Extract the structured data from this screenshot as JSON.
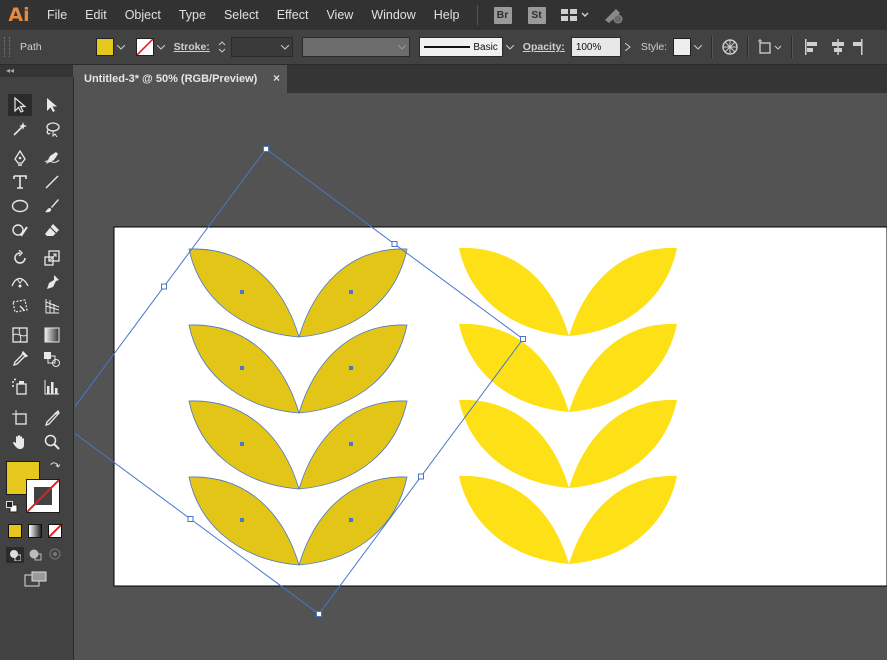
{
  "app": {
    "logo": "Ai"
  },
  "menu": [
    "File",
    "Edit",
    "Object",
    "Type",
    "Select",
    "Effect",
    "View",
    "Window",
    "Help"
  ],
  "bridge": {
    "br": "Br",
    "st": "St"
  },
  "control": {
    "selection": "Path",
    "fill_color": "#e5c71e",
    "stroke_label": "Stroke:",
    "brush_label": "Basic",
    "opacity_label": "Opacity:",
    "opacity_value": "100%",
    "style_label": "Style:"
  },
  "document": {
    "tab_title": "Untitled-3* @ 50% (RGB/Preview)",
    "close": "×"
  },
  "toolbar": {
    "collapse": "◂◂",
    "fill_color": "#e5c71e"
  },
  "artwork": {
    "selected_color": "#e3c518",
    "unselected_color": "#fee016",
    "selection_color": "#4a76c9",
    "artboard_color": "#ffffff"
  }
}
